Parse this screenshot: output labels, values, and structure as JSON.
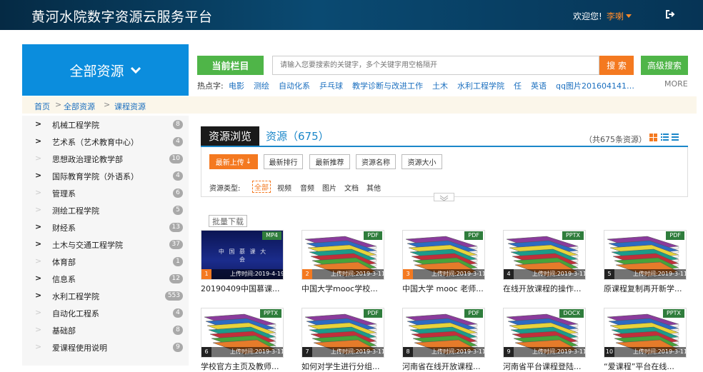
{
  "header": {
    "title": "黄河水院数字资源云服务平台",
    "welcome": "欢迎您!",
    "username": "李喇"
  },
  "all_resources": "全部资源",
  "search": {
    "current_column": "当前栏目",
    "placeholder": "请输入您要搜索的关键字，多个关键字用空格隔开",
    "search_label": "搜 索",
    "advanced_label": "高级搜索",
    "hot_label": "热点字:",
    "hot_words": [
      "电影",
      "测绘",
      "自动化系",
      "乒乓球",
      "教学诊断与改进工作",
      "土木",
      "水利工程学院",
      "任",
      "英语",
      "qq图片201604141…"
    ],
    "more": "MORE"
  },
  "breadcrumb": [
    "首页",
    "全部资源",
    "课程资源"
  ],
  "sidebar": [
    {
      "label": "机械工程学院",
      "count": "8",
      "has_children": true
    },
    {
      "label": "艺术系（艺术教育中心）",
      "count": "4",
      "has_children": true
    },
    {
      "label": "思想政治理论教学部",
      "count": "10",
      "has_children": false
    },
    {
      "label": "国际教育学院（外语系）",
      "count": "4",
      "has_children": true
    },
    {
      "label": "管理系",
      "count": "6",
      "has_children": false
    },
    {
      "label": "测绘工程学院",
      "count": "5",
      "has_children": false
    },
    {
      "label": "财经系",
      "count": "13",
      "has_children": true
    },
    {
      "label": "土木与交通工程学院",
      "count": "37",
      "has_children": true
    },
    {
      "label": "体育部",
      "count": "1",
      "has_children": false
    },
    {
      "label": "信息系",
      "count": "12",
      "has_children": true
    },
    {
      "label": "水利工程学院",
      "count": "553",
      "has_children": true
    },
    {
      "label": "自动化工程系",
      "count": "4",
      "has_children": false
    },
    {
      "label": "基础部",
      "count": "8",
      "has_children": false
    },
    {
      "label": "爱课程使用说明",
      "count": "9",
      "has_children": false
    }
  ],
  "browse": {
    "tab": "资源浏览",
    "resources_title": "资源（675）",
    "total": "（共675条资源）"
  },
  "sort_buttons": [
    "最新上传",
    "最新排行",
    "最新推荐",
    "资源名称",
    "资源大小"
  ],
  "types": {
    "label": "资源类型:",
    "items": [
      "全部",
      "视频",
      "音频",
      "图片",
      "文档",
      "其他"
    ]
  },
  "bulk_download": "批量下载",
  "cards": [
    {
      "type": "MP4",
      "rank": "1",
      "time": "上传时间:2019-4-19",
      "name": "20190409中国慕课...",
      "thumb": "conference",
      "conf_text": "中 国 慕 课 大 会"
    },
    {
      "type": "PDF",
      "rank": "2",
      "time": "上传时间:2019-3-11",
      "name": "中国大学mooc学校...",
      "thumb": "books"
    },
    {
      "type": "PDF",
      "rank": "3",
      "time": "上传时间:2019-3-11",
      "name": "中国大学 mooc 老师...",
      "thumb": "books"
    },
    {
      "type": "PPTX",
      "rank": "4",
      "time": "上传时间:2019-3-11",
      "name": "在线开放课程的操作...",
      "thumb": "books"
    },
    {
      "type": "PDF",
      "rank": "5",
      "time": "上传时间:2019-3-11",
      "name": "原课程复制再开新学...",
      "thumb": "books"
    },
    {
      "type": "PPTX",
      "rank": "6",
      "time": "上传时间:2019-3-11",
      "name": "学校官方主页及教师...",
      "thumb": "books"
    },
    {
      "type": "PDF",
      "rank": "7",
      "time": "上传时间:2019-3-11",
      "name": "如何对学生进行分组...",
      "thumb": "books"
    },
    {
      "type": "PDF",
      "rank": "8",
      "time": "上传时间:2019-3-11",
      "name": "河南省在线开放课程...",
      "thumb": "books"
    },
    {
      "type": "DOCX",
      "rank": "9",
      "time": "上传时间:2019-3-11",
      "name": "河南省平台课程登陆...",
      "thumb": "books"
    },
    {
      "type": "PPTX",
      "rank": "10",
      "time": "上传时间:2019-3-11",
      "name": "“爱课程”平台在线...",
      "thumb": "books"
    }
  ]
}
